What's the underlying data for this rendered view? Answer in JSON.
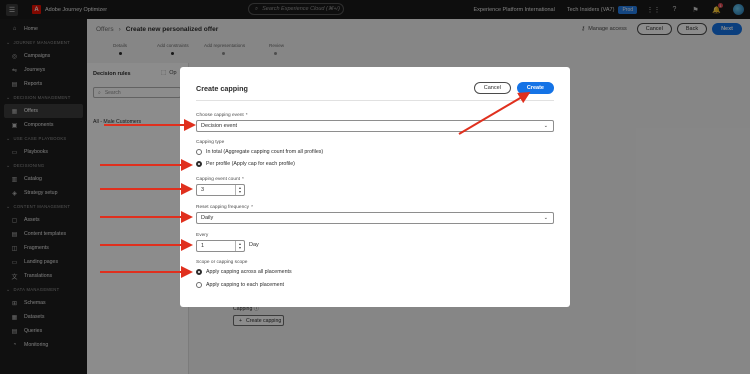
{
  "topbar": {
    "app_name": "Adobe Journey Optimizer",
    "search_placeholder": "Search Experience Cloud (⌘+/)",
    "platform": "Experience Platform International",
    "org": "Tech Insiders (VA7)",
    "env_badge": "Prod",
    "notification_count": "1"
  },
  "sidebar": {
    "home": "Home",
    "sections": [
      {
        "title": "JOURNEY MANAGEMENT",
        "items": [
          "Campaigns",
          "Journeys",
          "Reports"
        ]
      },
      {
        "title": "DECISION MANAGEMENT",
        "items": [
          "Offers",
          "Components"
        ]
      },
      {
        "title": "USE CASE PLAYBOOKS",
        "items": [
          "Playbooks"
        ]
      },
      {
        "title": "DECISIONING",
        "items": [
          "Catalog",
          "Strategy setup"
        ]
      },
      {
        "title": "CONTENT MANAGEMENT",
        "items": [
          "Assets",
          "Content templates",
          "Fragments",
          "Landing pages",
          "Translations"
        ]
      },
      {
        "title": "DATA MANAGEMENT",
        "items": [
          "Schemas",
          "Datasets",
          "Queries",
          "Monitoring"
        ]
      }
    ]
  },
  "header": {
    "breadcrumb_root": "Offers",
    "breadcrumb_current": "Create new personalized offer",
    "manage_access": "Manage access",
    "cancel": "Cancel",
    "back": "Back",
    "next": "Next"
  },
  "steps": [
    "Details",
    "Add constraints",
    "Add representations",
    "Review"
  ],
  "panel": {
    "title": "Decision rules",
    "optional_label": "Op",
    "search_placeholder": "Search",
    "rule": "All - Male Customers",
    "capping_label": "Capping",
    "create_capping": "Create capping"
  },
  "modal": {
    "title": "Create capping",
    "cancel": "Cancel",
    "create": "Create",
    "event_label": "Choose capping event",
    "event_value": "Decision event",
    "type_label": "Capping type",
    "type_total": "In total (Aggregate capping count from all profiles)",
    "type_profile": "Per profile (Apply cap for each profile)",
    "count_label": "Capping event count",
    "count_value": "3",
    "reset_label": "Reset capping frequency",
    "reset_value": "Daily",
    "every_label": "Every",
    "every_value": "1",
    "every_unit": "Day",
    "scope_label": "Scope or capping scope",
    "scope_all": "Apply capping across all placements",
    "scope_each": "Apply capping to each placement"
  },
  "colors": {
    "accent": "#1473e6",
    "arrow": "#e0301e",
    "sidebar_bg": "#1e1e1e",
    "topbar_bg": "#1b1b1b"
  }
}
